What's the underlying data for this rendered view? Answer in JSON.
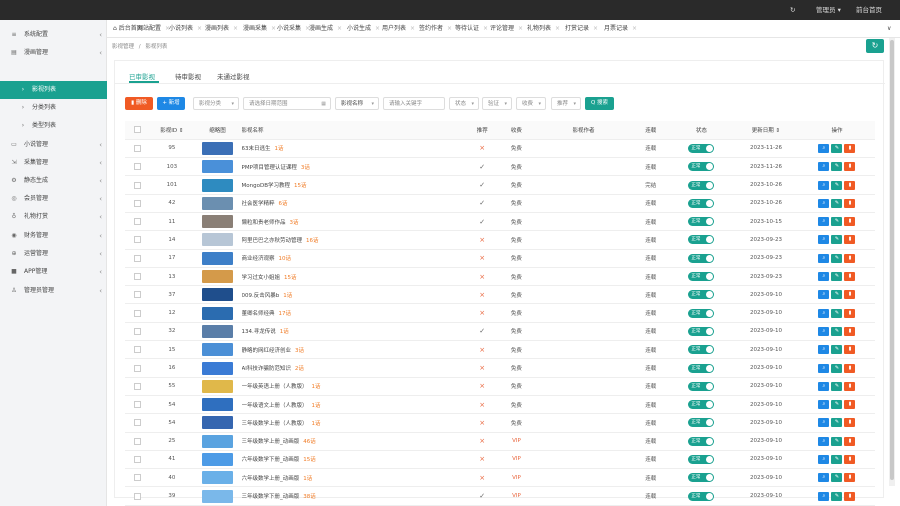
{
  "topbar": {
    "refresh_icon": "↻",
    "admin_label": "管理员",
    "caret": "▾",
    "backend_home": "前台首页"
  },
  "sidebar": {
    "items": [
      {
        "icon": "≡",
        "label": "系统配置",
        "chevron": "‹"
      },
      {
        "icon": "▤",
        "label": "漫画管理",
        "chevron": "‹"
      },
      {
        "icon": "›",
        "label": "影视列表",
        "chevron": ""
      },
      {
        "icon": "›",
        "label": "分类列表",
        "chevron": ""
      },
      {
        "icon": "›",
        "label": "类型列表",
        "chevron": ""
      },
      {
        "icon": "▭",
        "label": "小说管理",
        "chevron": "‹"
      },
      {
        "icon": "⇲",
        "label": "采集管理",
        "chevron": "‹"
      },
      {
        "icon": "⚙",
        "label": "静态生成",
        "chevron": "‹"
      },
      {
        "icon": "◎",
        "label": "会员管理",
        "chevron": "‹"
      },
      {
        "icon": "♁",
        "label": "礼物打赏",
        "chevron": "‹"
      },
      {
        "icon": "◉",
        "label": "财务管理",
        "chevron": "‹"
      },
      {
        "icon": "⊕",
        "label": "运营管理",
        "chevron": "‹"
      },
      {
        "icon": "■",
        "label": "APP管理",
        "chevron": "‹"
      },
      {
        "icon": "♙",
        "label": "管理员管理",
        "chevron": "‹"
      }
    ]
  },
  "tabs": [
    {
      "label": "⌂ 后台首页",
      "close": ""
    },
    {
      "label": "网站配置",
      "close": "×"
    },
    {
      "label": "小说列表",
      "close": "×"
    },
    {
      "label": "漫画列表",
      "close": "×"
    },
    {
      "label": "漫画采集",
      "close": "×"
    },
    {
      "label": "小说采集",
      "close": "×"
    },
    {
      "label": "漫画生成",
      "close": "×"
    },
    {
      "label": "小说生成",
      "close": "×"
    },
    {
      "label": "用户列表",
      "close": "×"
    },
    {
      "label": "签约作者",
      "close": "×"
    },
    {
      "label": "等待认证",
      "close": "×"
    },
    {
      "label": "评论管理",
      "close": "×"
    },
    {
      "label": "礼物列表",
      "close": "×"
    },
    {
      "label": "打赏记录",
      "close": "×"
    },
    {
      "label": "月票记录",
      "close": "×"
    }
  ],
  "tab_more": "∨",
  "breadcrumb": {
    "a": "影视管理",
    "sep": "/",
    "b": "影视列表"
  },
  "refresh_btn": "↻",
  "panel_tabs": [
    "已审影视",
    "待审影视",
    "未通过影视"
  ],
  "toolbar": {
    "delete": "删除",
    "add": "+ 新增",
    "category": "影视分类",
    "date_placeholder": "请选择日期范围",
    "calendar_icon": "▦",
    "name_field": "影视名称",
    "keyword_placeholder": "请输入关键字",
    "status": "状态",
    "serial": "验证",
    "charge": "收费",
    "recommend": "推荐",
    "search": "Q 搜索"
  },
  "table": {
    "headers": [
      "影视ID ⇕",
      "缩略图",
      "影视名称",
      "推荐",
      "收费",
      "影视作者",
      "连载",
      "状态",
      "更新日期 ⇕",
      "操作"
    ],
    "rows": [
      {
        "id": "95",
        "name": "63末日逃生",
        "ep": "1话",
        "rec": "×",
        "fee": "免费",
        "serial": "连载",
        "date": "2023-11-26",
        "thumb": "#3b6fb6"
      },
      {
        "id": "103",
        "name": "PMP项目管理认证课程",
        "ep": "3话",
        "rec": "✓",
        "fee": "免费",
        "serial": "连载",
        "date": "2023-11-26",
        "thumb": "#4a90d9"
      },
      {
        "id": "101",
        "name": "MongoDB学习教程",
        "ep": "15话",
        "rec": "✓",
        "fee": "免费",
        "serial": "完结",
        "date": "2023-10-26",
        "thumb": "#2e8bc0"
      },
      {
        "id": "42",
        "name": "社会医学精粹",
        "ep": "6话",
        "rec": "✓",
        "fee": "免费",
        "serial": "连载",
        "date": "2023-10-26",
        "thumb": "#6b8fb0"
      },
      {
        "id": "11",
        "name": "懒粒和贵老师作品",
        "ep": "3话",
        "rec": "✓",
        "fee": "免费",
        "serial": "连载",
        "date": "2023-10-15",
        "thumb": "#8a7f76"
      },
      {
        "id": "14",
        "name": "阿里巴巴之亦秋劳动管理",
        "ep": "16话",
        "rec": "×",
        "fee": "免费",
        "serial": "连载",
        "date": "2023-09-23",
        "thumb": "#b7c6d6"
      },
      {
        "id": "17",
        "name": "商业经济观察",
        "ep": "10话",
        "rec": "×",
        "fee": "免费",
        "serial": "连载",
        "date": "2023-09-23",
        "thumb": "#3d7fc8"
      },
      {
        "id": "13",
        "name": "学习过女小姐姐",
        "ep": "15话",
        "rec": "×",
        "fee": "免费",
        "serial": "连载",
        "date": "2023-09-23",
        "thumb": "#d49a4a"
      },
      {
        "id": "37",
        "name": "009.反击风暴b",
        "ep": "1话",
        "rec": "×",
        "fee": "免费",
        "serial": "连载",
        "date": "2023-09-10",
        "thumb": "#1f4e8c"
      },
      {
        "id": "12",
        "name": "董卿名师经典",
        "ep": "17话",
        "rec": "×",
        "fee": "免费",
        "serial": "连载",
        "date": "2023-09-10",
        "thumb": "#2b6cb0"
      },
      {
        "id": "32",
        "name": "134.寻龙传说",
        "ep": "1话",
        "rec": "✓",
        "fee": "免费",
        "serial": "连载",
        "date": "2023-09-10",
        "thumb": "#5a7ea8"
      },
      {
        "id": "15",
        "name": "静略的网红经济创业",
        "ep": "3话",
        "rec": "×",
        "fee": "免费",
        "serial": "连载",
        "date": "2023-09-10",
        "thumb": "#4b8fd6"
      },
      {
        "id": "16",
        "name": "AI科技诈骗防范知识",
        "ep": "2话",
        "rec": "×",
        "fee": "免费",
        "serial": "连载",
        "date": "2023-09-10",
        "thumb": "#3a7bd5"
      },
      {
        "id": "55",
        "name": "一年级英语上册（人教版）",
        "ep": "1话",
        "rec": "×",
        "fee": "免费",
        "serial": "连载",
        "date": "2023-09-10",
        "thumb": "#e0b84a"
      },
      {
        "id": "54",
        "name": "一年级语文上册（人教版）",
        "ep": "1话",
        "rec": "×",
        "fee": "免费",
        "serial": "连载",
        "date": "2023-09-10",
        "thumb": "#2f6fbf"
      },
      {
        "id": "54",
        "name": "三年级数学上册（人教版）",
        "ep": "1话",
        "rec": "×",
        "fee": "免费",
        "serial": "连载",
        "date": "2023-09-10",
        "thumb": "#3566b0"
      },
      {
        "id": "25",
        "name": "三年级数学上册_动画版",
        "ep": "46话",
        "rec": "×",
        "fee": "VIP",
        "serial": "连载",
        "date": "2023-09-10",
        "thumb": "#5aa3e0"
      },
      {
        "id": "41",
        "name": "六年级数学下册_动画版",
        "ep": "15话",
        "rec": "×",
        "fee": "VIP",
        "serial": "连载",
        "date": "2023-09-10",
        "thumb": "#4d9be6"
      },
      {
        "id": "40",
        "name": "六年级数学上册_动画版",
        "ep": "1话",
        "rec": "×",
        "fee": "VIP",
        "serial": "连载",
        "date": "2023-09-10",
        "thumb": "#6ab0e8"
      },
      {
        "id": "39",
        "name": "三年级数学下册_动画版",
        "ep": "38话",
        "rec": "✓",
        "fee": "VIP",
        "serial": "连载",
        "date": "2023-09-10",
        "thumb": "#7ab8ea"
      }
    ],
    "status_label": "正常"
  },
  "accent": "#1aa190"
}
